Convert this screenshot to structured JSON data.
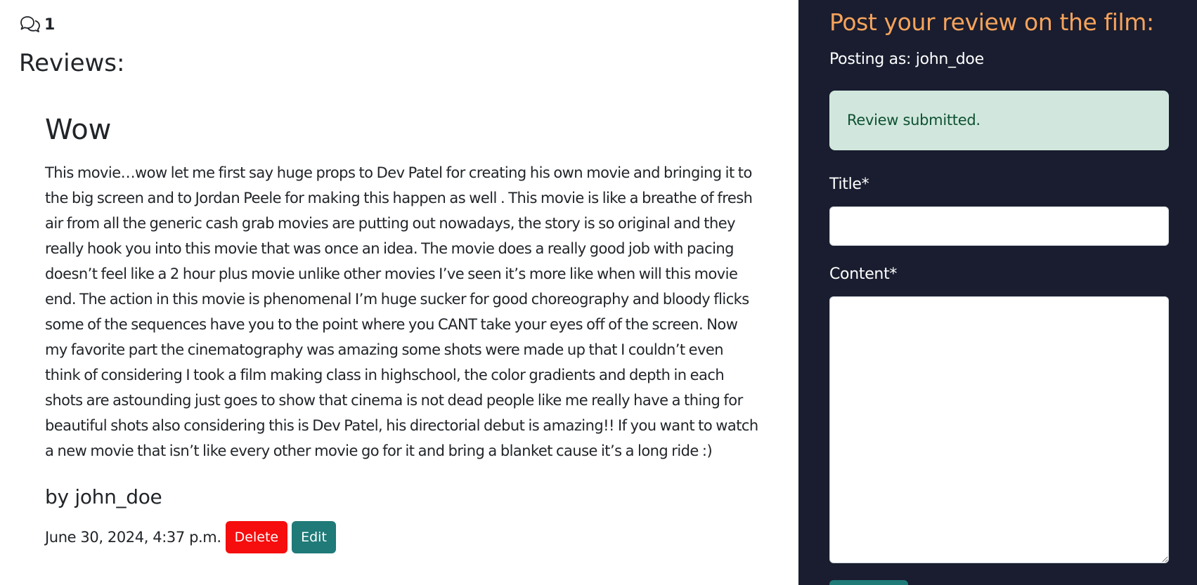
{
  "comments": {
    "count": "1",
    "icon": "chat-bubbles-icon"
  },
  "reviews_heading": "Reviews:",
  "review": {
    "title": "Wow",
    "body": "This movie…wow let me first say huge props to Dev Patel for creating his own movie and bringing it to the big screen and to Jordan Peele for making this happen as well . This movie is like a breathe of fresh air from all the generic cash grab movies are putting out nowadays, the story is so original and they really hook you into this movie that was once an idea. The movie does a really good job with pacing doesn’t feel like a 2 hour plus movie unlike other movies I’ve seen it’s more like when will this movie end. The action in this movie is phenomenal I’m huge sucker for good choreography and bloody flicks some of the sequences have you to the point where you CANT take your eyes off of the screen. Now my favorite part the cinematography was amazing some shots were made up that I couldn’t even think of considering I took a film making class in highschool, the color gradients and depth in each shots are astounding just goes to show that cinema is not dead people like me really have a thing for beautiful shots also considering this is Dev Patel, his directorial debut is amazing!! If you want to watch a new movie that isn’t like every other movie go for it and bring a blanket cause it’s a long ride :)",
    "author": "by john_doe",
    "date": "June 30, 2024, 4:37 p.m.",
    "delete_label": "Delete",
    "edit_label": "Edit"
  },
  "sidebar": {
    "heading": "Post your review on the film:",
    "posting_as": "Posting as: john_doe",
    "alert": "Review submitted.",
    "title_label": "Title*",
    "title_value": "",
    "content_label": "Content*",
    "content_value": ""
  },
  "colors": {
    "sidebar_bg": "#191d2f",
    "heading_accent": "#f7a35b",
    "alert_bg": "#d1e7dd",
    "delete_button": "#f60d0d",
    "edit_button": "#1f7a78"
  }
}
